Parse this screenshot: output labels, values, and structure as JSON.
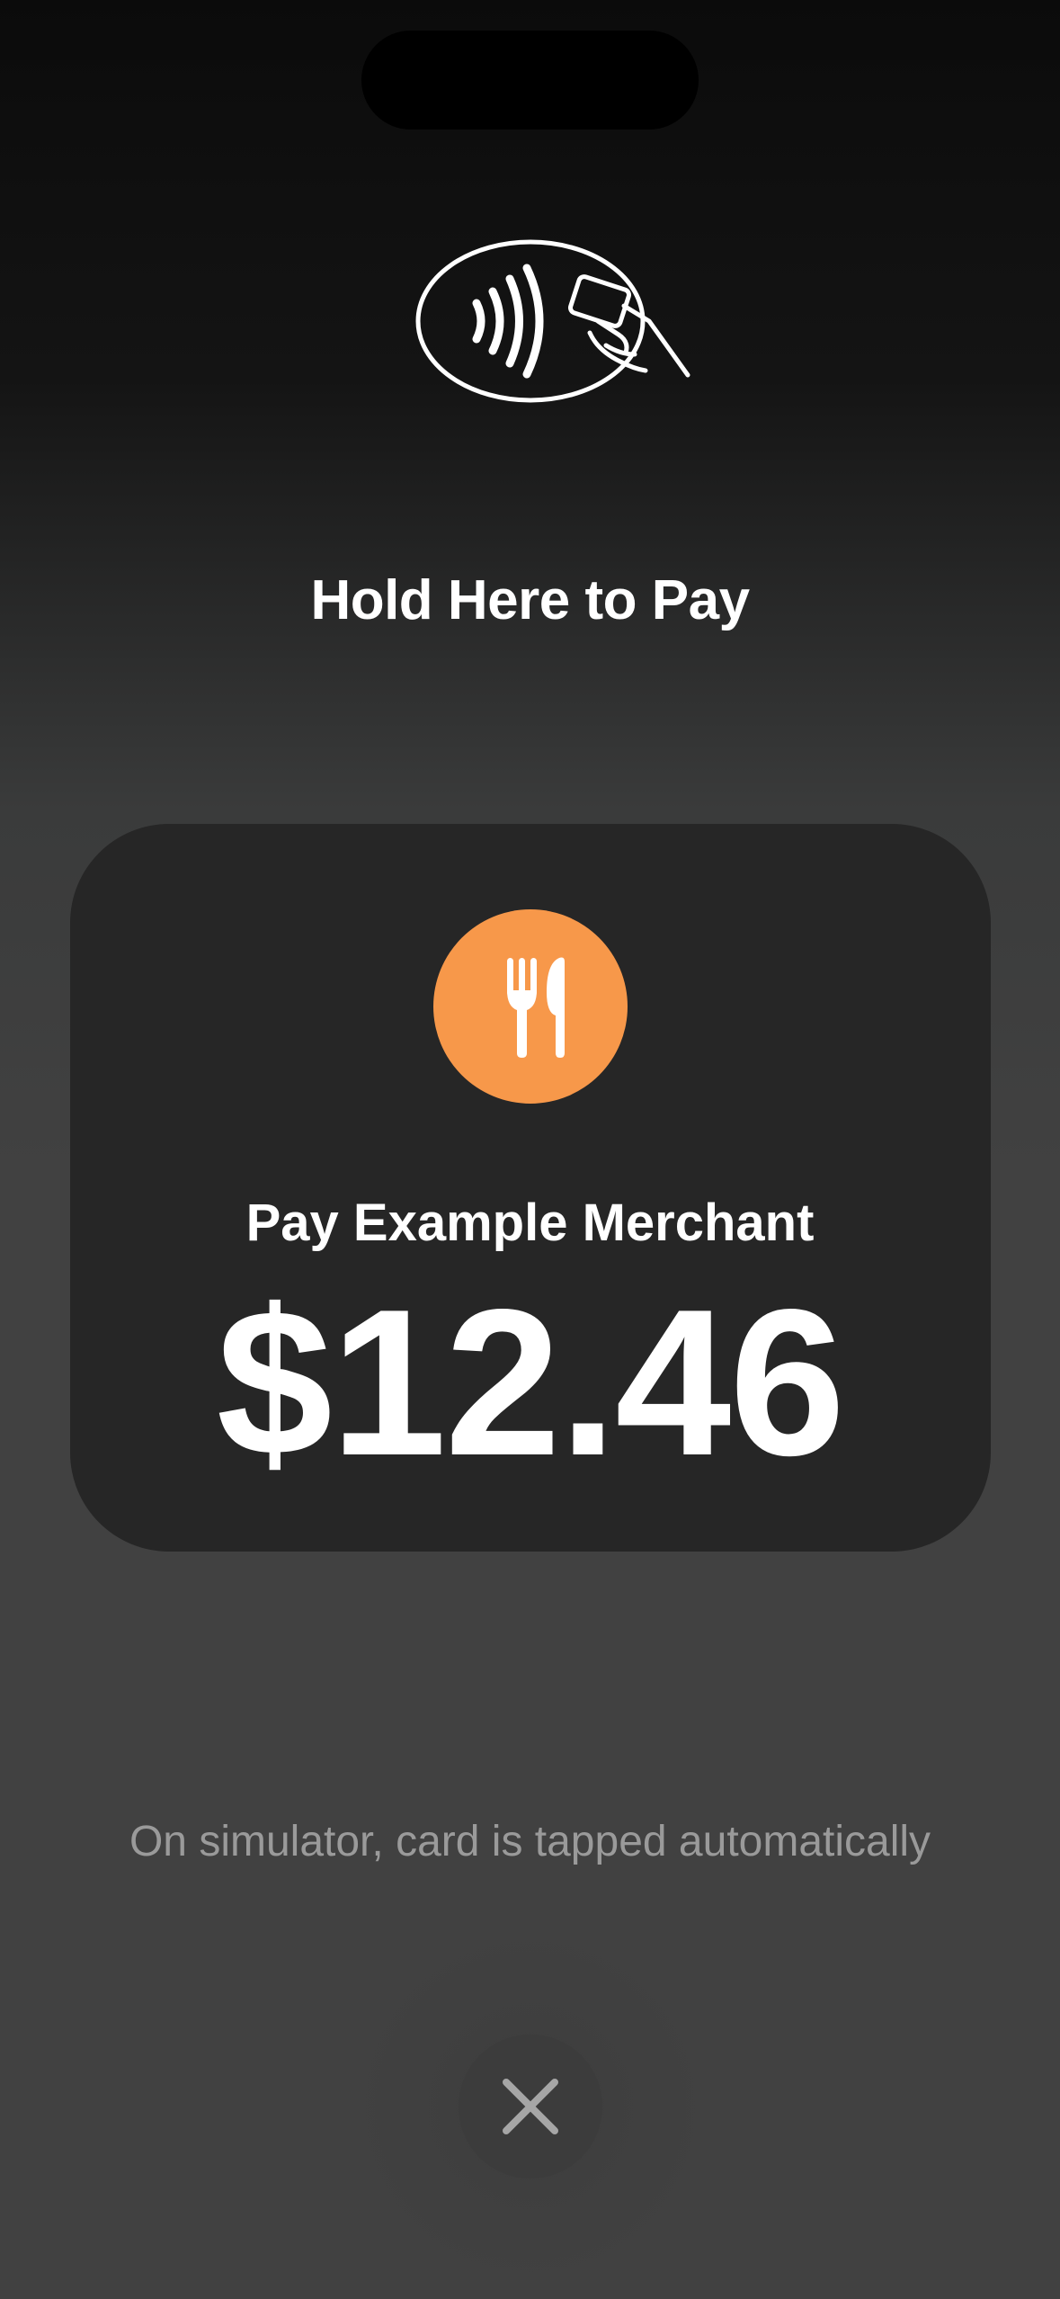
{
  "icons": {
    "contactless": "contactless-tap-icon",
    "merchant": "fork-knife-icon",
    "close": "close-icon"
  },
  "colors": {
    "merchant_logo_bg": "#f7984a",
    "card_bg": "#262626",
    "text_primary": "#ffffff",
    "text_secondary": "#9a9a9a"
  },
  "prompt": {
    "title": "Hold Here to Pay"
  },
  "payment": {
    "merchant_label": "Pay Example Merchant",
    "amount": "$12.46"
  },
  "footer": {
    "note": "On simulator, card is tapped automatically"
  }
}
